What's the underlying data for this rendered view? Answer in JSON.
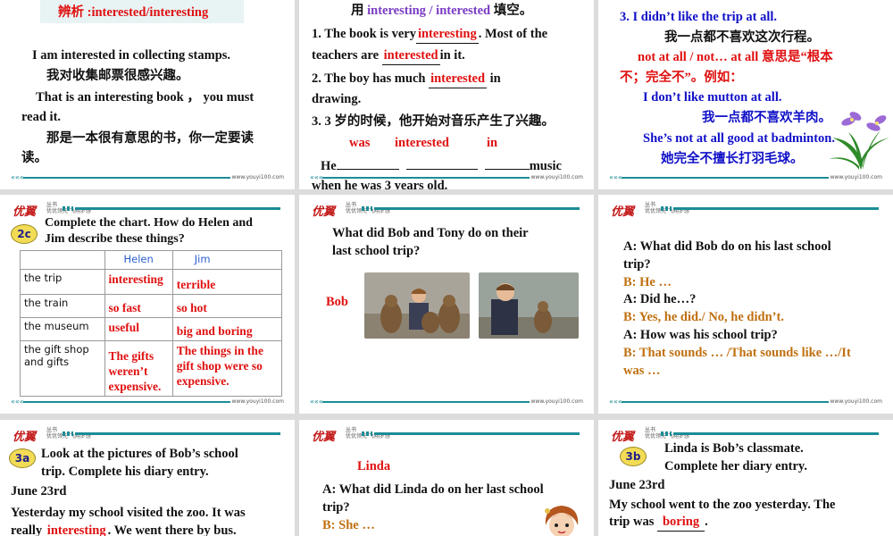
{
  "branding": {
    "logo": "优翼",
    "logo_suffix": "丛书",
    "tagline_1": "优优领先 飞翔梦想",
    "tagline_2": "成人成才",
    "url": "www.youyi100.com"
  },
  "s1": {
    "title": "辨析 :interested/interesting",
    "en1": "I am interested in collecting stamps.",
    "cn1": "我对收集邮票很感兴趣。",
    "en2a": "That is an interesting book ，  you must",
    "en2b": "read it.",
    "cn2a": "那是一本很有意思的书，你一定要读",
    "cn2b": "读。"
  },
  "s2": {
    "l0a": "用",
    "l0b": "interesting / interested",
    "l0c": "填空。",
    "q1a": "1. The book is very",
    "q1ans": "interesting",
    "q1b": ". Most of the",
    "q1c": "teachers are",
    "q1ans2": "interested",
    "q1d": "in it.",
    "q2a": "2. The boy has much",
    "q2ans": "interested",
    "q2b": "in",
    "q2c": "drawing.",
    "q3a": "3. 3 岁的时候，他开始对音乐产生了兴趣。",
    "q3w1": "was",
    "q3w2": "interested",
    "q3w3": "in",
    "q3b": "He",
    "q3c": "music",
    "q3d": "when he was 3 years old."
  },
  "s3": {
    "l1": "3. I didn’t like the trip at all.",
    "l2": "我一点都不喜欢这次行程。",
    "l3a": "not at all / not… at all",
    "l3b": "意思是“根本",
    "l4": "不；完全不”。例如：",
    "l5": "I don’t like mutton at all.",
    "l6": "我一点都不喜欢羊肉。",
    "l7": "She’s not at all good at badminton.",
    "l8": "她完全不擅长打羽毛球。"
  },
  "s4": {
    "badge": "2c",
    "inst1": "Complete the chart. How do Helen and",
    "inst2": "Jim describe these things?",
    "headers": [
      "",
      "Helen",
      "Jim"
    ],
    "rows": [
      {
        "item": "the trip",
        "helen": "interesting",
        "jim": "terrible"
      },
      {
        "item": "the train",
        "helen": "so fast",
        "jim": "so hot"
      },
      {
        "item": "the museum",
        "helen": "useful",
        "jim": "big and boring"
      },
      {
        "item": "the gift shop and gifts",
        "helen": "The gifts weren’t expensive.",
        "jim": "The things in the gift shop were so expensive."
      }
    ]
  },
  "s5": {
    "q1": "What did Bob and Tony do on their",
    "q2": "last school trip?",
    "label": "Bob"
  },
  "s6": {
    "l1": "A: What did Bob do on his last school",
    "l2": "trip?",
    "l3": "B: He …",
    "l4": "A: Did he…?",
    "l5": "B: Yes, he did./ No, he didn’t.",
    "l6": "A: How was his school trip?",
    "l7": "B: That sounds … /That sounds like …/It",
    "l8": "was …"
  },
  "s7": {
    "badge": "3a",
    "l1": "Look at the pictures of Bob’s school",
    "l2": "trip. Complete his diary entry.",
    "date": "June 23rd",
    "l3": "Yesterday my school visited the zoo. It was",
    "l4a": "really",
    "l4ans": "interesting",
    "l4b": ". We went there by bus."
  },
  "s8": {
    "name": "Linda",
    "l1": "A: What did Linda do on her last school",
    "l2": "trip?",
    "l3": "B: She …"
  },
  "s9": {
    "badge": "3b",
    "l1": "Linda is Bob’s classmate.",
    "l2": "Complete her diary entry.",
    "date": "June 23rd",
    "l3": "My school went to the zoo yesterday. The",
    "l4a": "trip was",
    "l4ans": "boring",
    "l4b": "."
  }
}
